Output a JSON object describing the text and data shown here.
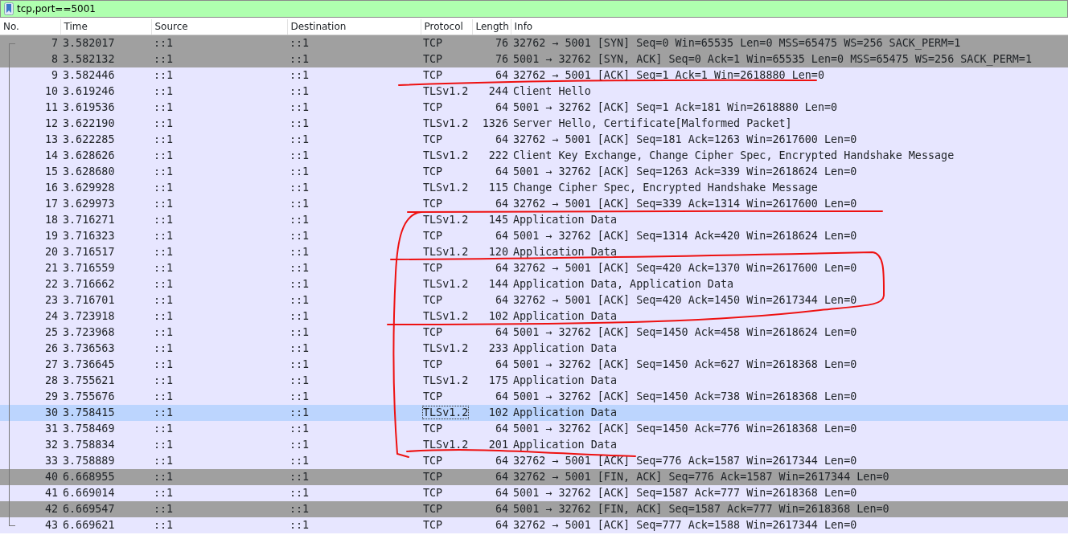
{
  "filter": {
    "value": "tcp,port==5001"
  },
  "columns": [
    "No.",
    "Time",
    "Source",
    "Destination",
    "Protocol",
    "Length",
    "Info"
  ],
  "rows": [
    {
      "no": "7",
      "time": "3.582017",
      "source": "::1",
      "destination": "::1",
      "protocol": "TCP",
      "length": "76",
      "info": "32762 → 5001 [SYN] Seq=0 Win=65535 Len=0 MSS=65475 WS=256 SACK_PERM=1",
      "color": "#a0a0a0",
      "selected": false
    },
    {
      "no": "8",
      "time": "3.582132",
      "source": "::1",
      "destination": "::1",
      "protocol": "TCP",
      "length": "76",
      "info": "5001 → 32762 [SYN, ACK] Seq=0 Ack=1 Win=65535 Len=0 MSS=65475 WS=256 SACK_PERM=1",
      "color": "#a0a0a0",
      "selected": false
    },
    {
      "no": "9",
      "time": "3.582446",
      "source": "::1",
      "destination": "::1",
      "protocol": "TCP",
      "length": "64",
      "info": "32762 → 5001 [ACK] Seq=1 Ack=1 Win=2618880 Len=0",
      "color": "#e7e6ff",
      "selected": false
    },
    {
      "no": "10",
      "time": "3.619246",
      "source": "::1",
      "destination": "::1",
      "protocol": "TLSv1.2",
      "length": "244",
      "info": "Client Hello",
      "color": "#e7e6ff",
      "selected": false
    },
    {
      "no": "11",
      "time": "3.619536",
      "source": "::1",
      "destination": "::1",
      "protocol": "TCP",
      "length": "64",
      "info": "5001 → 32762 [ACK] Seq=1 Ack=181 Win=2618880 Len=0",
      "color": "#e7e6ff",
      "selected": false
    },
    {
      "no": "12",
      "time": "3.622190",
      "source": "::1",
      "destination": "::1",
      "protocol": "TLSv1.2",
      "length": "1326",
      "info": "Server Hello, Certificate[Malformed Packet]",
      "color": "#e7e6ff",
      "selected": false
    },
    {
      "no": "13",
      "time": "3.622285",
      "source": "::1",
      "destination": "::1",
      "protocol": "TCP",
      "length": "64",
      "info": "32762 → 5001 [ACK] Seq=181 Ack=1263 Win=2617600 Len=0",
      "color": "#e7e6ff",
      "selected": false
    },
    {
      "no": "14",
      "time": "3.628626",
      "source": "::1",
      "destination": "::1",
      "protocol": "TLSv1.2",
      "length": "222",
      "info": "Client Key Exchange, Change Cipher Spec, Encrypted Handshake Message",
      "color": "#e7e6ff",
      "selected": false
    },
    {
      "no": "15",
      "time": "3.628680",
      "source": "::1",
      "destination": "::1",
      "protocol": "TCP",
      "length": "64",
      "info": "5001 → 32762 [ACK] Seq=1263 Ack=339 Win=2618624 Len=0",
      "color": "#e7e6ff",
      "selected": false
    },
    {
      "no": "16",
      "time": "3.629928",
      "source": "::1",
      "destination": "::1",
      "protocol": "TLSv1.2",
      "length": "115",
      "info": "Change Cipher Spec, Encrypted Handshake Message",
      "color": "#e7e6ff",
      "selected": false
    },
    {
      "no": "17",
      "time": "3.629973",
      "source": "::1",
      "destination": "::1",
      "protocol": "TCP",
      "length": "64",
      "info": "32762 → 5001 [ACK] Seq=339 Ack=1314 Win=2617600 Len=0",
      "color": "#e7e6ff",
      "selected": false
    },
    {
      "no": "18",
      "time": "3.716271",
      "source": "::1",
      "destination": "::1",
      "protocol": "TLSv1.2",
      "length": "145",
      "info": "Application Data",
      "color": "#e7e6ff",
      "selected": false
    },
    {
      "no": "19",
      "time": "3.716323",
      "source": "::1",
      "destination": "::1",
      "protocol": "TCP",
      "length": "64",
      "info": "5001 → 32762 [ACK] Seq=1314 Ack=420 Win=2618624 Len=0",
      "color": "#e7e6ff",
      "selected": false
    },
    {
      "no": "20",
      "time": "3.716517",
      "source": "::1",
      "destination": "::1",
      "protocol": "TLSv1.2",
      "length": "120",
      "info": "Application Data",
      "color": "#e7e6ff",
      "selected": false
    },
    {
      "no": "21",
      "time": "3.716559",
      "source": "::1",
      "destination": "::1",
      "protocol": "TCP",
      "length": "64",
      "info": "32762 → 5001 [ACK] Seq=420 Ack=1370 Win=2617600 Len=0",
      "color": "#e7e6ff",
      "selected": false
    },
    {
      "no": "22",
      "time": "3.716662",
      "source": "::1",
      "destination": "::1",
      "protocol": "TLSv1.2",
      "length": "144",
      "info": "Application Data, Application Data",
      "color": "#e7e6ff",
      "selected": false
    },
    {
      "no": "23",
      "time": "3.716701",
      "source": "::1",
      "destination": "::1",
      "protocol": "TCP",
      "length": "64",
      "info": "32762 → 5001 [ACK] Seq=420 Ack=1450 Win=2617344 Len=0",
      "color": "#e7e6ff",
      "selected": false
    },
    {
      "no": "24",
      "time": "3.723918",
      "source": "::1",
      "destination": "::1",
      "protocol": "TLSv1.2",
      "length": "102",
      "info": "Application Data",
      "color": "#e7e6ff",
      "selected": false
    },
    {
      "no": "25",
      "time": "3.723968",
      "source": "::1",
      "destination": "::1",
      "protocol": "TCP",
      "length": "64",
      "info": "5001 → 32762 [ACK] Seq=1450 Ack=458 Win=2618624 Len=0",
      "color": "#e7e6ff",
      "selected": false
    },
    {
      "no": "26",
      "time": "3.736563",
      "source": "::1",
      "destination": "::1",
      "protocol": "TLSv1.2",
      "length": "233",
      "info": "Application Data",
      "color": "#e7e6ff",
      "selected": false
    },
    {
      "no": "27",
      "time": "3.736645",
      "source": "::1",
      "destination": "::1",
      "protocol": "TCP",
      "length": "64",
      "info": "5001 → 32762 [ACK] Seq=1450 Ack=627 Win=2618368 Len=0",
      "color": "#e7e6ff",
      "selected": false
    },
    {
      "no": "28",
      "time": "3.755621",
      "source": "::1",
      "destination": "::1",
      "protocol": "TLSv1.2",
      "length": "175",
      "info": "Application Data",
      "color": "#e7e6ff",
      "selected": false
    },
    {
      "no": "29",
      "time": "3.755676",
      "source": "::1",
      "destination": "::1",
      "protocol": "TCP",
      "length": "64",
      "info": "5001 → 32762 [ACK] Seq=1450 Ack=738 Win=2618368 Len=0",
      "color": "#e7e6ff",
      "selected": false
    },
    {
      "no": "30",
      "time": "3.758415",
      "source": "::1",
      "destination": "::1",
      "protocol": "TLSv1.2",
      "length": "102",
      "info": "Application Data",
      "selected": true
    },
    {
      "no": "31",
      "time": "3.758469",
      "source": "::1",
      "destination": "::1",
      "protocol": "TCP",
      "length": "64",
      "info": "5001 → 32762 [ACK] Seq=1450 Ack=776 Win=2618368 Len=0",
      "color": "#e7e6ff",
      "selected": false
    },
    {
      "no": "32",
      "time": "3.758834",
      "source": "::1",
      "destination": "::1",
      "protocol": "TLSv1.2",
      "length": "201",
      "info": "Application Data",
      "color": "#e7e6ff",
      "selected": false
    },
    {
      "no": "33",
      "time": "3.758889",
      "source": "::1",
      "destination": "::1",
      "protocol": "TCP",
      "length": "64",
      "info": "32762 → 5001 [ACK] Seq=776 Ack=1587 Win=2617344 Len=0",
      "color": "#e7e6ff",
      "selected": false
    },
    {
      "no": "40",
      "time": "6.668955",
      "source": "::1",
      "destination": "::1",
      "protocol": "TCP",
      "length": "64",
      "info": "32762 → 5001 [FIN, ACK] Seq=776 Ack=1587 Win=2617344 Len=0",
      "color": "#a0a0a0",
      "selected": false
    },
    {
      "no": "41",
      "time": "6.669014",
      "source": "::1",
      "destination": "::1",
      "protocol": "TCP",
      "length": "64",
      "info": "5001 → 32762 [ACK] Seq=1587 Ack=777 Win=2618368 Len=0",
      "color": "#e7e6ff",
      "selected": false
    },
    {
      "no": "42",
      "time": "6.669547",
      "source": "::1",
      "destination": "::1",
      "protocol": "TCP",
      "length": "64",
      "info": "5001 → 32762 [FIN, ACK] Seq=1587 Ack=777 Win=2618368 Len=0",
      "color": "#a0a0a0",
      "selected": false
    },
    {
      "no": "43",
      "time": "6.669621",
      "source": "::1",
      "destination": "::1",
      "protocol": "TCP",
      "length": "64",
      "info": "32762 → 5001 [ACK] Seq=777 Ack=1588 Win=2617344 Len=0",
      "color": "#e7e6ff",
      "selected": false
    }
  ]
}
